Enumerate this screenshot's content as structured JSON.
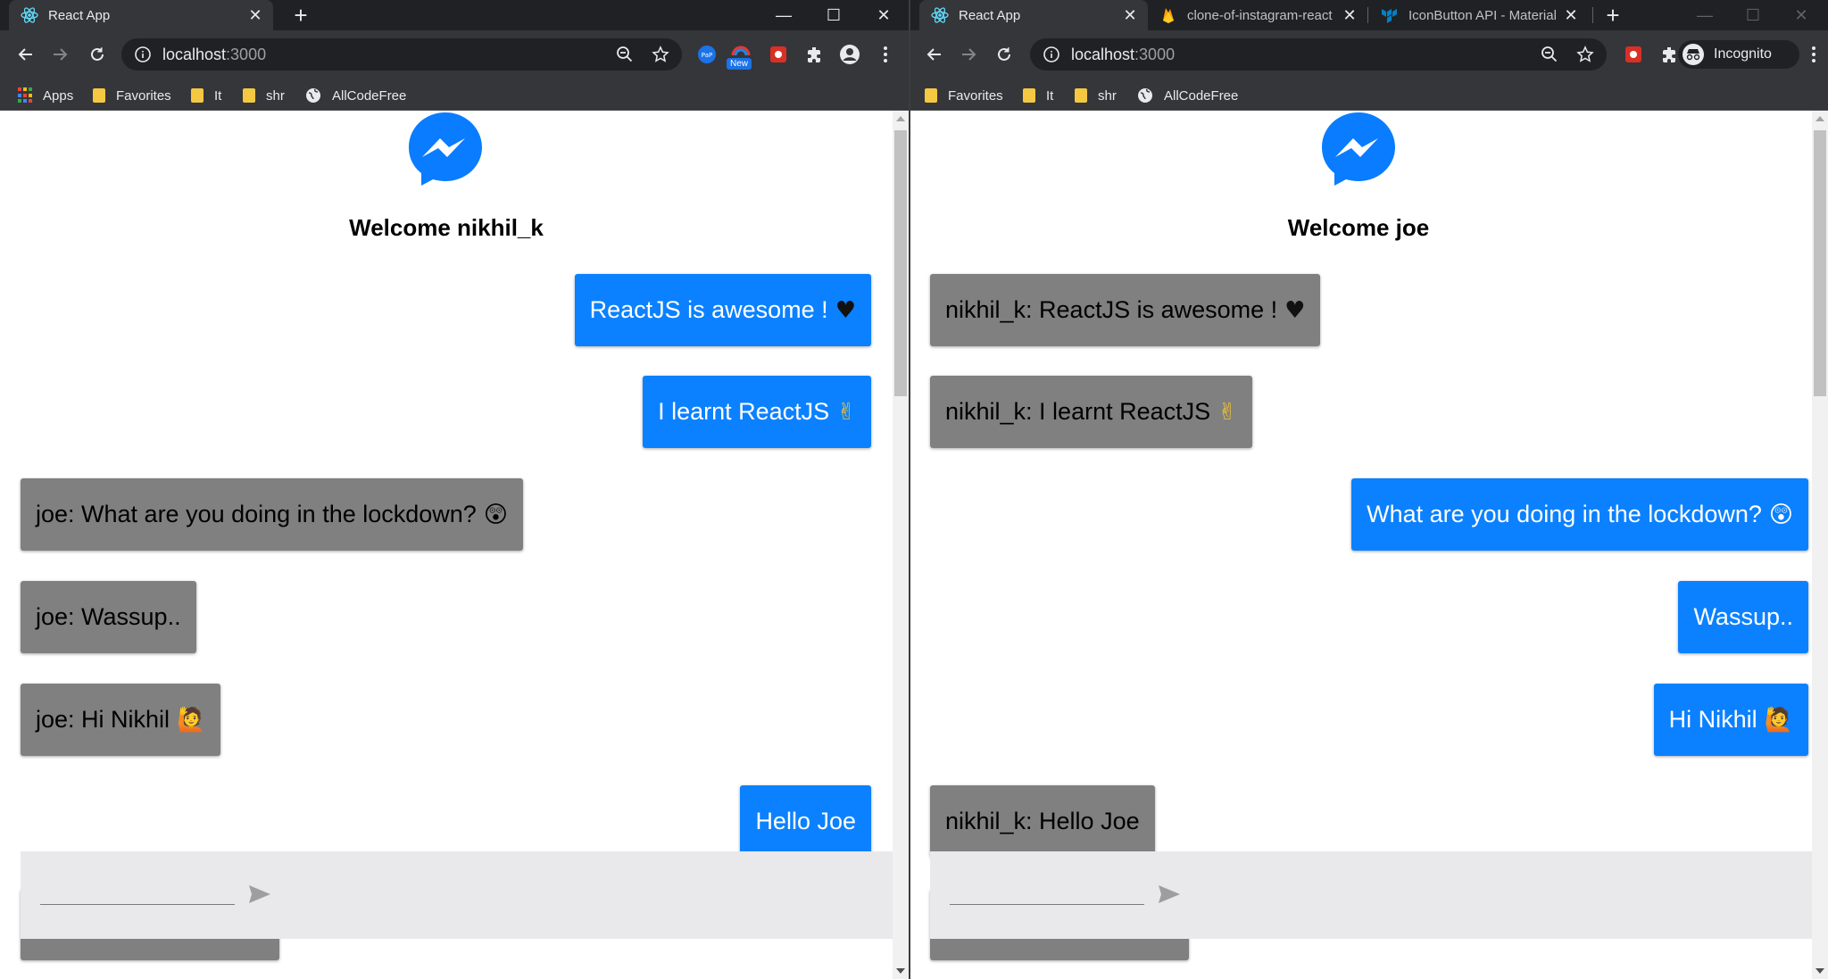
{
  "left": {
    "tabs": [
      {
        "title": "React App"
      }
    ],
    "address": {
      "host": "localhost",
      "port": ":3000"
    },
    "bookmarks": [
      "Apps",
      "Favorites",
      "It",
      "shr",
      "AllCodeFree"
    ],
    "extension_badge": "New",
    "welcome": "Welcome nikhil_k",
    "messages": [
      {
        "text": "ReactJS is awesome !",
        "emoji": "♥",
        "side": "mine"
      },
      {
        "text": "I learnt ReactJS",
        "emoji": "✌",
        "side": "mine"
      },
      {
        "text": "joe: What are you doing in the lockdown?",
        "emoji": "😲",
        "side": "theirs"
      },
      {
        "text": "joe: Wassup..",
        "emoji": "",
        "side": "theirs"
      },
      {
        "text": "joe: Hi Nikhil",
        "emoji": "🙋",
        "side": "theirs"
      },
      {
        "text": "Hello Joe",
        "emoji": "",
        "side": "mine"
      }
    ]
  },
  "right": {
    "tabs": [
      {
        "title": "React App"
      },
      {
        "title": "clone-of-instagram-react"
      },
      {
        "title": "IconButton API - Material"
      }
    ],
    "address": {
      "host": "localhost",
      "port": ":3000"
    },
    "bookmarks": [
      "Favorites",
      "It",
      "shr",
      "AllCodeFree"
    ],
    "profile_label": "Incognito",
    "welcome": "Welcome joe",
    "messages": [
      {
        "text": "nikhil_k: ReactJS is awesome !",
        "emoji": "♥",
        "side": "theirs"
      },
      {
        "text": "nikhil_k: I learnt ReactJS",
        "emoji": "✌",
        "side": "theirs"
      },
      {
        "text": "What are you doing in the lockdown?",
        "emoji": "😲",
        "side": "mine"
      },
      {
        "text": "Wassup..",
        "emoji": "",
        "side": "mine"
      },
      {
        "text": "Hi Nikhil",
        "emoji": "🙋",
        "side": "mine"
      },
      {
        "text": "nikhil_k: Hello Joe",
        "emoji": "",
        "side": "theirs"
      }
    ]
  },
  "colors": {
    "mine_bubble": "#0b81ff",
    "theirs_bubble": "#808080",
    "messenger_blue": "#0a7cff"
  },
  "icons": [
    "back-icon",
    "forward-icon",
    "reload-icon",
    "info-icon",
    "zoom-icon",
    "star-icon",
    "extensions-icon",
    "profile-icon",
    "menu-icon",
    "send-icon",
    "messenger-logo-icon"
  ]
}
